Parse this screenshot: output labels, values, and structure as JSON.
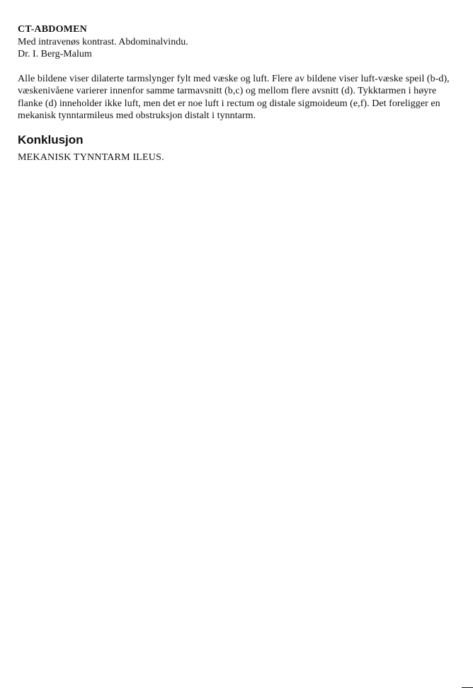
{
  "report": {
    "title": "CT-ABDOMEN",
    "contrast_line": "Med intravenøs kontrast. Abdominalvindu.",
    "doctor": "Dr. I. Berg-Malum",
    "findings": "Alle bildene viser dilaterte tarmslynger fylt med væske og luft. Flere av bildene viser luft-væske speil (b-d), væskenivåene varierer innenfor samme tarmavsnitt (b,c) og mellom flere avsnitt (d). Tykktarmen i høyre flanke (d) inneholder ikke luft, men det er noe luft i rectum og distale sigmoideum (e,f). Det foreligger en mekanisk tynntarmileus med obstruksjon distalt i tynntarm.",
    "conclusion_heading": "Konklusjon",
    "conclusion_text": "MEKANISK TYNNTARM ILEUS."
  }
}
